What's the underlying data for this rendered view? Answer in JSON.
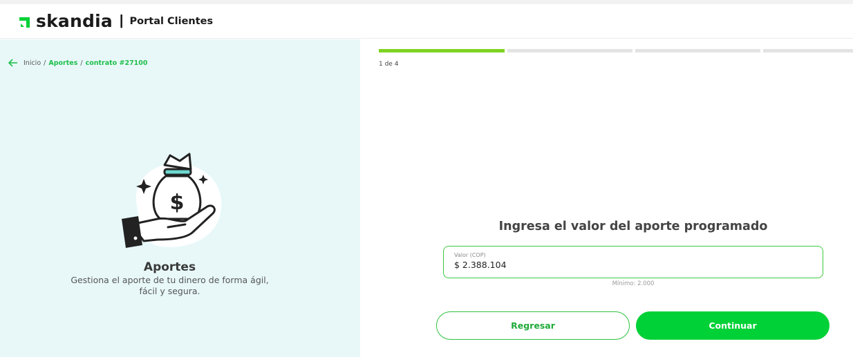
{
  "header": {
    "brand": "skandia",
    "separator": "|",
    "portal_title": "Portal Clientes"
  },
  "breadcrumb": {
    "home": "Inicio",
    "sep1": "/",
    "section": "Aportes",
    "sep2": "/",
    "contract": "contrato #27100"
  },
  "promo": {
    "title": "Aportes",
    "description_line1": "Gestiona el aporte de tu dinero de forma ágil,",
    "description_line2": "fácil y segura.",
    "icon": "hand-money-bag-icon"
  },
  "progress": {
    "current_step": 1,
    "total_steps": 4,
    "step_text": "1 de 4"
  },
  "form": {
    "question": "Ingresa el valor del aporte programado",
    "field_label": "Valor (COP)",
    "field_value": "$ 2.388.104",
    "hint": "Mínimo: 2.000"
  },
  "buttons": {
    "back_label": "Regresar",
    "next_label": "Continuar"
  },
  "colors": {
    "brand_green": "#00d136",
    "progress_green": "#7ed321",
    "link_green": "#1fbf4b",
    "panel_bg": "#e8f8f9"
  }
}
